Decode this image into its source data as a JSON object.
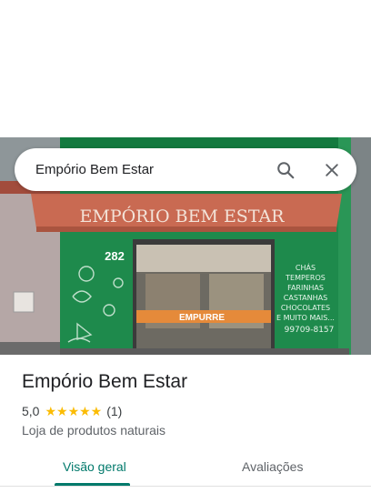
{
  "search": {
    "query": "Empório Bem Estar",
    "search_icon": "search-icon",
    "close_icon": "close-icon"
  },
  "photo": {
    "sign_text": "EMPÓRIO BEM ESTAR",
    "street_number": "282",
    "door_sign": "EMPURRE",
    "window_text": [
      "CHÁS",
      "TEMPEROS",
      "FARINHAS",
      "CASTANHAS",
      "CHOCOLATES",
      "E MUITO MAIS..."
    ],
    "phone": "99709-8157"
  },
  "place": {
    "name": "Empório Bem Estar",
    "rating": "5,0",
    "stars": "★★★★★",
    "review_count": "(1)",
    "category": "Loja de produtos naturais"
  },
  "tabs": {
    "overview": "Visão geral",
    "reviews": "Avaliações"
  },
  "colors": {
    "accent": "#00796b",
    "star": "#fbbc04",
    "storefront_green": "#1e8a4c",
    "awning": "#c96a52"
  }
}
